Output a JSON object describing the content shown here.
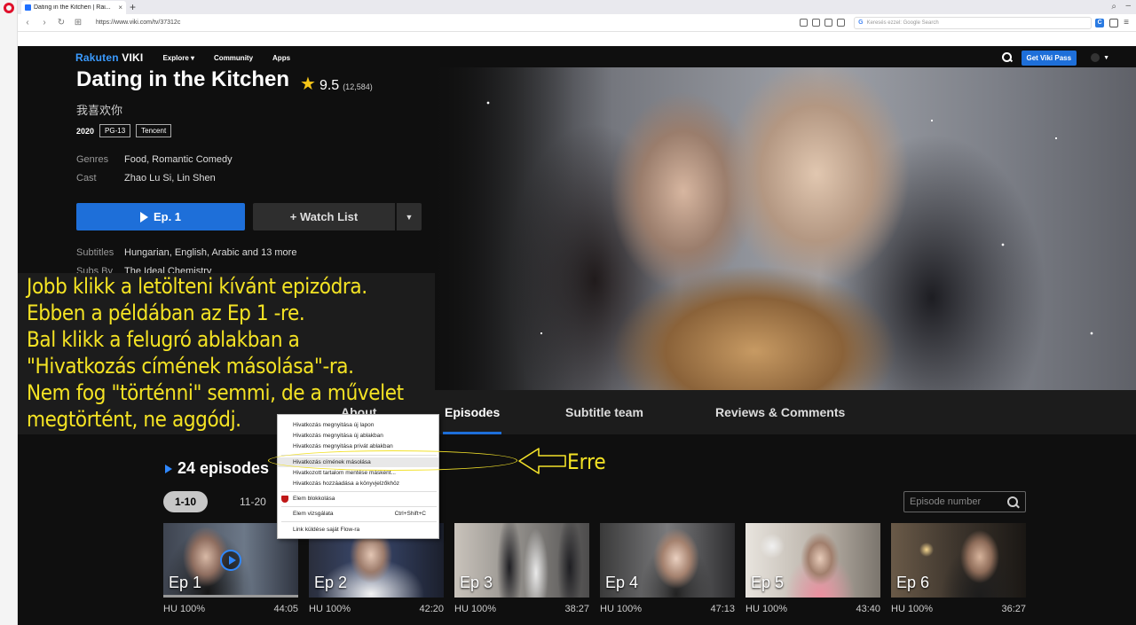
{
  "browser": {
    "tab_title": "Dating in the Kitchen | Rai...",
    "tab_close": "×",
    "new_tab": "+",
    "url": "https://www.viki.com/tv/37312c",
    "search_placeholder": "Keresés ezzel: Google Search"
  },
  "nav": {
    "logo_a": "Rakuten",
    "logo_b": "VIKI",
    "explore": "Explore ▾",
    "community": "Community",
    "apps": "Apps",
    "viki_pass": "Get Viki Pass",
    "avatar_caret": "▼"
  },
  "show": {
    "title": "Dating in the Kitchen",
    "rating": "9.5",
    "rating_count": "(12,584)",
    "native_title": "我喜欢你",
    "year": "2020",
    "age_rating": "PG-13",
    "network": "Tencent",
    "genres_label": "Genres",
    "genres": "Food, Romantic Comedy",
    "cast_label": "Cast",
    "cast": "Zhao Lu Si, Lin Shen",
    "subtitles_label": "Subtitles",
    "subtitles": "Hungarian, English, Arabic and 13 more",
    "subsby_label": "Subs By",
    "subsby": "The Ideal Chemistry",
    "play_label": "Ep. 1",
    "watchlist_label": "+ Watch List"
  },
  "tabs": [
    "About",
    "Episodes",
    "Subtitle team",
    "Reviews & Comments"
  ],
  "episodes": {
    "heading": "24 episodes",
    "ranges": [
      "1-10",
      "11-20"
    ],
    "search_placeholder": "Episode number",
    "items": [
      {
        "label": "Ep 1",
        "subs": "HU 100%",
        "duration": "44:05",
        "watched": 1.0
      },
      {
        "label": "Ep 2",
        "subs": "HU 100%",
        "duration": "42:20"
      },
      {
        "label": "Ep 3",
        "subs": "HU 100%",
        "duration": "38:27"
      },
      {
        "label": "Ep 4",
        "subs": "HU 100%",
        "duration": "47:13"
      },
      {
        "label": "Ep 5",
        "subs": "HU 100%",
        "duration": "43:40"
      },
      {
        "label": "Ep 6",
        "subs": "HU 100%",
        "duration": "36:27"
      }
    ]
  },
  "context_menu": {
    "items": [
      {
        "label": "Hivatkozás megnyitása új lapon",
        "shortcut": ""
      },
      {
        "label": "Hivatkozás megnyitása új ablakban",
        "shortcut": ""
      },
      {
        "label": "Hivatkozás megnyitása privát ablakban",
        "shortcut": ""
      },
      {
        "label": "Hivatkozás címének másolása",
        "shortcut": ""
      },
      {
        "label": "Hivatkozott tartalom mentése másként...",
        "shortcut": ""
      },
      {
        "label": "Hivatkozás hozzáadása a könyvjelzőkhöz",
        "shortcut": ""
      },
      {
        "label": "Elem blokkolása",
        "shortcut": ""
      },
      {
        "label": "Elem vizsgálata",
        "shortcut": "Ctrl+Shift+C"
      },
      {
        "label": "Link küldése saját Flow-ra",
        "shortcut": ""
      }
    ]
  },
  "annotation": {
    "lines": [
      "Jobb klikk a letölteni kívánt epizódra.",
      "Ebben a példában az Ep 1 -re.",
      "Bal klikk a felugró ablakban a",
      "\"Hivatkozás címének másolása\"-ra.",
      "Nem fog \"történni\" semmi, de a művelet",
      "megtörtént, ne aggódj."
    ],
    "arrow_label": "Erre",
    "color": "#f4e324"
  },
  "colors": {
    "accent": "#1e6fd9",
    "background": "#0f0f0f"
  }
}
